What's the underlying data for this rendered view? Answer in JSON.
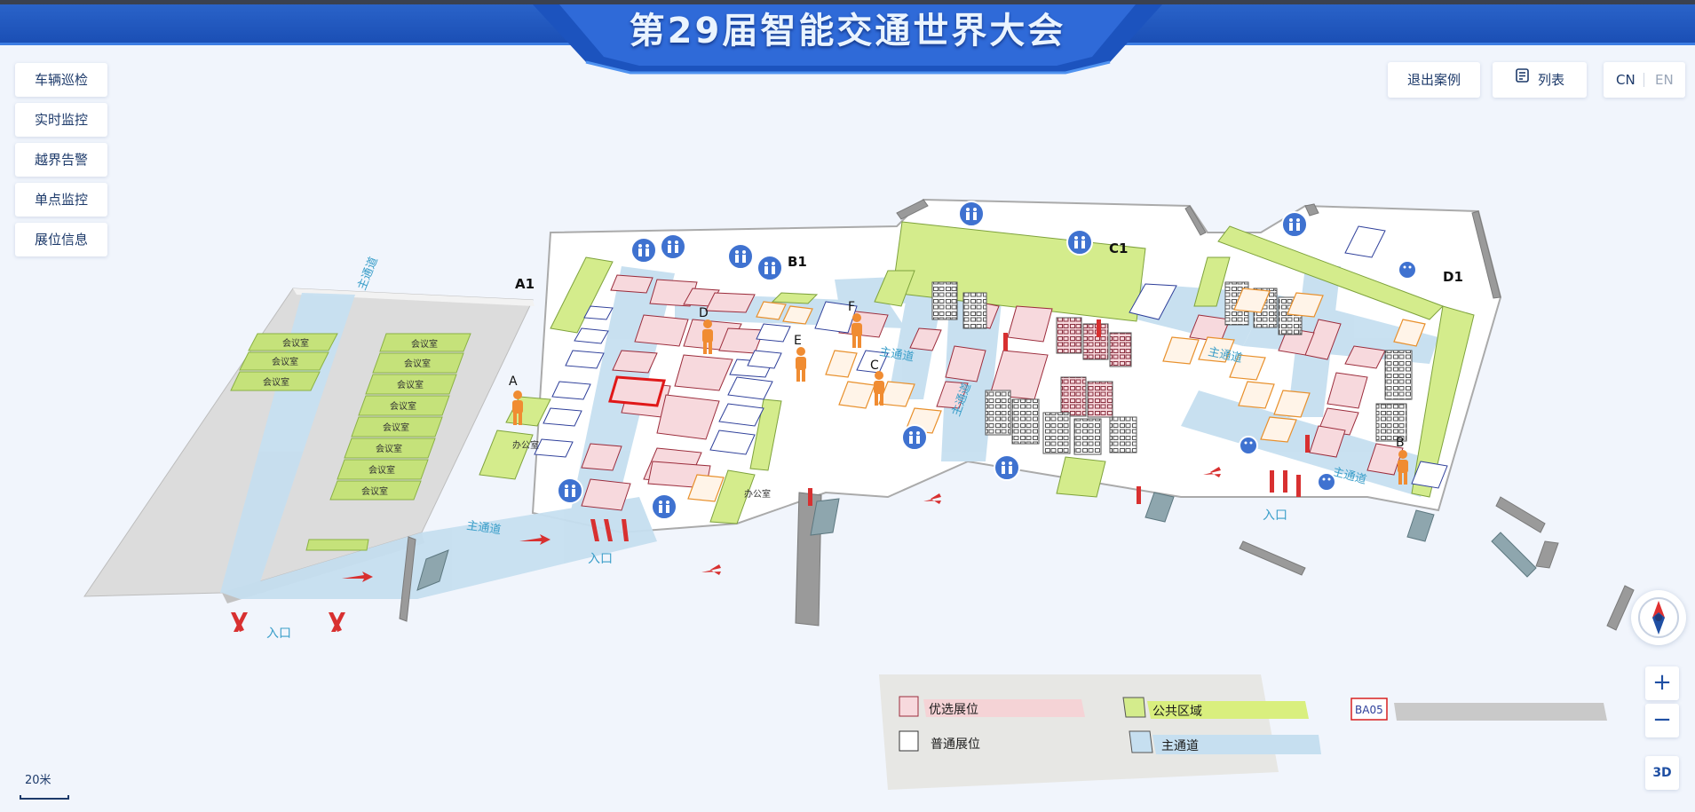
{
  "header": {
    "title": "第29届智能交通世界大会"
  },
  "menu": {
    "items": [
      {
        "label": "车辆巡检"
      },
      {
        "label": "实时监控"
      },
      {
        "label": "越界告警"
      },
      {
        "label": "单点监控"
      },
      {
        "label": "展位信息"
      }
    ]
  },
  "top_right": {
    "exit_label": "退出案例",
    "list_label": "列表",
    "lang_cn": "CN",
    "lang_en": "EN"
  },
  "map": {
    "halls": {
      "a1": "A1",
      "b1": "B1",
      "c1": "C1",
      "d1": "D1"
    },
    "points": {
      "a": "A",
      "b": "B",
      "c": "C",
      "d": "D",
      "e": "E",
      "f": "F"
    },
    "entrance": "入口",
    "main_road": "主通道",
    "meeting_room": "会议室",
    "office": "办公室"
  },
  "legend": {
    "preferred": "优选展位",
    "normal": "普通展位",
    "public": "公共区域",
    "main_road": "主通道",
    "code_sample": "BA05"
  },
  "controls": {
    "zoom_in": "+",
    "zoom_out": "−",
    "mode": "3D"
  },
  "scale": {
    "label": "20米"
  },
  "colors": {
    "header_blue": "#1a4eb4",
    "preferred_booth": "#f7d9dd",
    "public_area": "#d4ec8c",
    "main_road": "#c6dff0",
    "person_orange": "#f08c32",
    "restroom_blue": "#3f72d0"
  }
}
